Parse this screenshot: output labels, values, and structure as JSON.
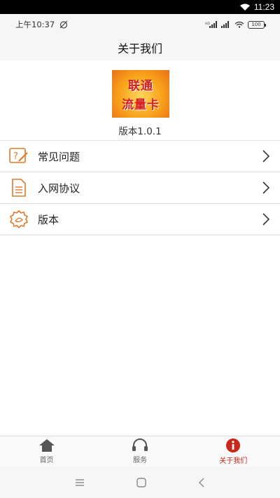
{
  "system_bar": {
    "time": "11:23"
  },
  "status_bar": {
    "time": "上午10:37",
    "battery": "100"
  },
  "header": {
    "title": "关于我们"
  },
  "logo": {
    "line1": "联通",
    "line2": "流量卡"
  },
  "version_text": "版本1.0.1",
  "menu": [
    {
      "label": "常见问题",
      "icon": "faq-edit-icon"
    },
    {
      "label": "入网协议",
      "icon": "document-icon"
    },
    {
      "label": "版本",
      "icon": "badge-icon"
    }
  ],
  "tabs": [
    {
      "label": "首页",
      "icon": "home-icon"
    },
    {
      "label": "服务",
      "icon": "headset-icon"
    },
    {
      "label": "关于我们",
      "icon": "info-icon",
      "active": true
    }
  ],
  "colors": {
    "accent": "#e07a2a",
    "active_tab": "#c8281c"
  }
}
